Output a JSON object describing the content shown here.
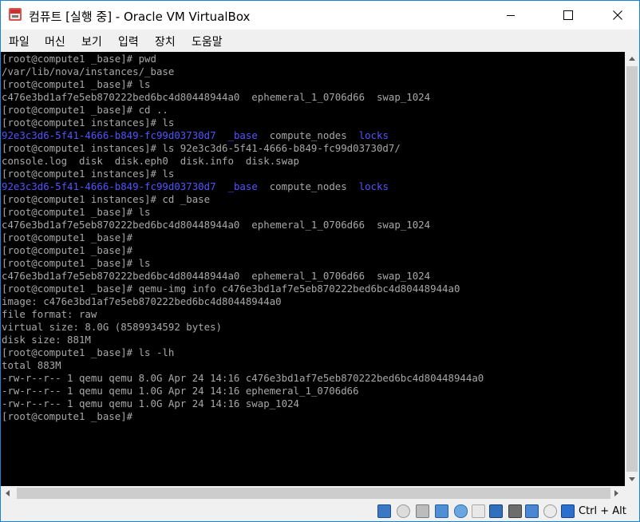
{
  "window": {
    "title": "컴퓨트 [실행 중] - Oracle VM VirtualBox"
  },
  "menu": [
    "파일",
    "머신",
    "보기",
    "입력",
    "장치",
    "도움말"
  ],
  "terminal": {
    "lines": [
      [
        {
          "t": "[root@compute1 _base]# pwd"
        }
      ],
      [
        {
          "t": "/var/lib/nova/instances/_base"
        }
      ],
      [
        {
          "t": "[root@compute1 _base]# ls"
        }
      ],
      [
        {
          "t": "c476e3bd1af7e5eb870222bed6bc4d80448944a0  ephemeral_1_0706d66  swap_1024"
        }
      ],
      [
        {
          "t": "[root@compute1 _base]# cd .."
        }
      ],
      [
        {
          "t": "[root@compute1 instances]# ls"
        }
      ],
      [
        {
          "t": "92e3c3d6-5f41-4666-b849-fc99d03730d7",
          "dir": true
        },
        {
          "t": "  "
        },
        {
          "t": "_base",
          "dir": true
        },
        {
          "t": "  compute_nodes  "
        },
        {
          "t": "locks",
          "dir": true
        }
      ],
      [
        {
          "t": "[root@compute1 instances]# ls 92e3c3d6-5f41-4666-b849-fc99d03730d7/"
        }
      ],
      [
        {
          "t": "console.log  disk  disk.eph0  disk.info  disk.swap"
        }
      ],
      [
        {
          "t": "[root@compute1 instances]# ls"
        }
      ],
      [
        {
          "t": "92e3c3d6-5f41-4666-b849-fc99d03730d7",
          "dir": true
        },
        {
          "t": "  "
        },
        {
          "t": "_base",
          "dir": true
        },
        {
          "t": "  compute_nodes  "
        },
        {
          "t": "locks",
          "dir": true
        }
      ],
      [
        {
          "t": "[root@compute1 instances]# cd _base"
        }
      ],
      [
        {
          "t": "[root@compute1 _base]# ls"
        }
      ],
      [
        {
          "t": "c476e3bd1af7e5eb870222bed6bc4d80448944a0  ephemeral_1_0706d66  swap_1024"
        }
      ],
      [
        {
          "t": "[root@compute1 _base]#"
        }
      ],
      [
        {
          "t": "[root@compute1 _base]#"
        }
      ],
      [
        {
          "t": "[root@compute1 _base]# ls"
        }
      ],
      [
        {
          "t": "c476e3bd1af7e5eb870222bed6bc4d80448944a0  ephemeral_1_0706d66  swap_1024"
        }
      ],
      [
        {
          "t": "[root@compute1 _base]# qemu-img info c476e3bd1af7e5eb870222bed6bc4d80448944a0"
        }
      ],
      [
        {
          "t": "image: c476e3bd1af7e5eb870222bed6bc4d80448944a0"
        }
      ],
      [
        {
          "t": "file format: raw"
        }
      ],
      [
        {
          "t": "virtual size: 8.0G (8589934592 bytes)"
        }
      ],
      [
        {
          "t": "disk size: 881M"
        }
      ],
      [
        {
          "t": "[root@compute1 _base]# ls -lh"
        }
      ],
      [
        {
          "t": "total 883M"
        }
      ],
      [
        {
          "t": "-rw-r--r-- 1 qemu qemu 8.0G Apr 24 14:16 c476e3bd1af7e5eb870222bed6bc4d80448944a0"
        }
      ],
      [
        {
          "t": "-rw-r--r-- 1 qemu qemu 1.0G Apr 24 14:16 ephemeral_1_0706d66"
        }
      ],
      [
        {
          "t": "-rw-r--r-- 1 qemu qemu 1.0G Apr 24 14:16 swap_1024"
        }
      ],
      [
        {
          "t": "[root@compute1 _base]#"
        }
      ]
    ]
  },
  "statusbar": {
    "icons": [
      "hard-disk-icon",
      "optical-drive-icon",
      "audio-icon",
      "network-icon",
      "usb-icon",
      "shared-folders-icon",
      "display-icon",
      "video-capture-icon",
      "cpu-virtualization-icon",
      "mouse-integration-icon",
      "keyboard-capture-icon"
    ],
    "host_key": "Ctrl + Alt"
  },
  "colors": {
    "terminal_bg": "#000000",
    "terminal_fg": "#a8a8a8",
    "directory": "#5454ff",
    "window_border": "#1883d7"
  }
}
